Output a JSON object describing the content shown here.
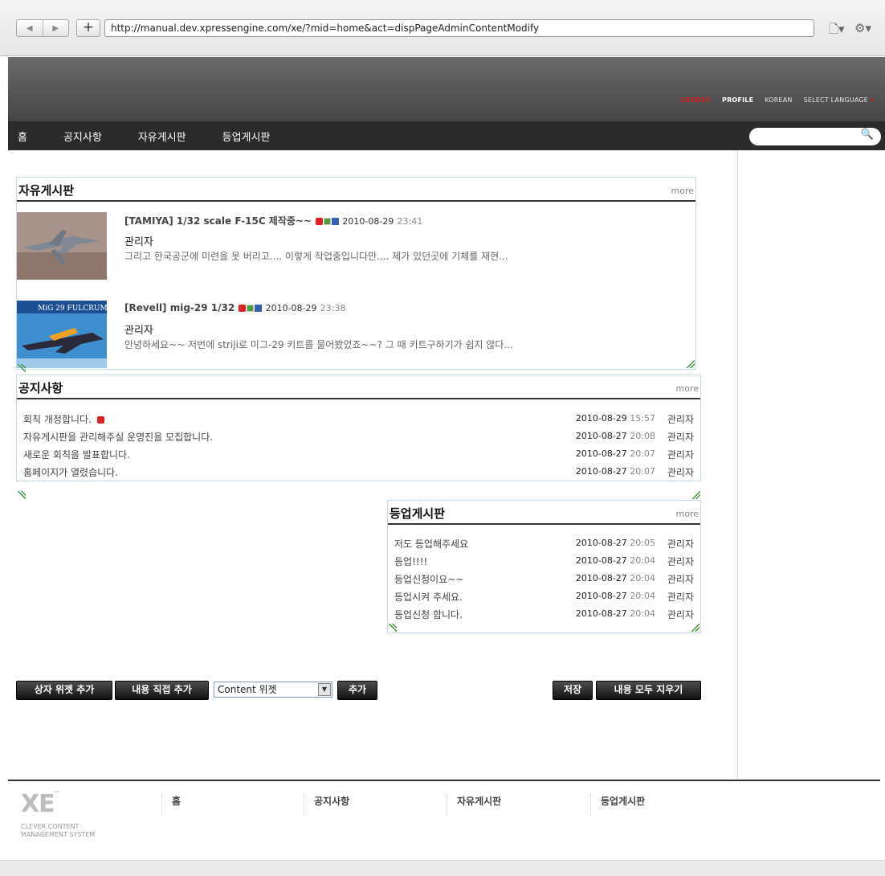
{
  "browser": {
    "back_glyph": "◀",
    "forward_glyph": "▶",
    "new_tab_glyph": "+",
    "url": "http://manual.dev.xpressengine.com/xe/?mid=home&act=dispPageAdminContentModify",
    "page_icon_glyph": "🗋▾",
    "gear_icon_glyph": "⚙▾"
  },
  "topmenu": {
    "logout": "LOGOUT",
    "profile": "PROFILE",
    "language": "KOREAN",
    "select_language": "SELECT LANGUAGE",
    "caret": "▾"
  },
  "gnb": {
    "items": [
      "홈",
      "공지사항",
      "자유게시판",
      "등업게시판"
    ],
    "search_glyph": "🔍"
  },
  "free_board": {
    "title": "자유게시판",
    "more": "more",
    "items": [
      {
        "title": "[TAMIYA] 1/32 scale F-15C 제작중~~",
        "date": "2010-08-29",
        "time": "23:41",
        "author": "관리자",
        "summary": "그리고 한국공군에 미련을 못 버리고.... 이렇게 작업중입니다만.... 제가 있던곳에 기체를 재현..."
      },
      {
        "title": "[Revell] mig-29 1/32",
        "date": "2010-08-29",
        "time": "23:38",
        "author": "관리자",
        "summary": "안녕하세요~~ 저번에 striji로 미그-29 키트를 물어봤었죠~~? 그 때 키트구하기가 쉽지 않다...",
        "thumb_caption": "MiG 29 FULCRUM"
      }
    ]
  },
  "notice_board": {
    "title": "공지사항",
    "more": "more",
    "items": [
      {
        "title": "회칙 개정합니다.",
        "date": "2010-08-29",
        "time": "15:57",
        "author": "관리자",
        "new": true
      },
      {
        "title": "자유게시판을 관리해주실 운영진을 모집합니다.",
        "date": "2010-08-27",
        "time": "20:08",
        "author": "관리자",
        "new": false
      },
      {
        "title": "새로운 회칙을 발표합니다.",
        "date": "2010-08-27",
        "time": "20:07",
        "author": "관리자",
        "new": false
      },
      {
        "title": "홈페이지가 열렸습니다.",
        "date": "2010-08-27",
        "time": "20:07",
        "author": "관리자",
        "new": false
      }
    ]
  },
  "levelup_board": {
    "title": "등업게시판",
    "more": "more",
    "items": [
      {
        "title": "저도 등업해주세요",
        "date": "2010-08-27",
        "time": "20:05",
        "author": "관리자"
      },
      {
        "title": "등업!!!!",
        "date": "2010-08-27",
        "time": "20:04",
        "author": "관리자"
      },
      {
        "title": "등업신청이요~~",
        "date": "2010-08-27",
        "time": "20:04",
        "author": "관리자"
      },
      {
        "title": "등업시켜 주세요.",
        "date": "2010-08-27",
        "time": "20:04",
        "author": "관리자"
      },
      {
        "title": "등업신청 합니다.",
        "date": "2010-08-27",
        "time": "20:04",
        "author": "관리자"
      }
    ]
  },
  "actions": {
    "add_box_widget": "상자 위젯 추가",
    "add_direct_content": "내용 직접 추가",
    "widget_select": "Content 위젯",
    "select_arrow": "▼",
    "add": "추가",
    "save": "저장",
    "clear_all": "내용 모두 지우기"
  },
  "footer": {
    "logo": "XE",
    "logo_tm": "™",
    "tagline_1": "CLEVER CONTENT",
    "tagline_2": "MANAGEMENT SYSTEM",
    "menu": [
      "홈",
      "공지사항",
      "자유게시판",
      "등업게시판"
    ]
  }
}
